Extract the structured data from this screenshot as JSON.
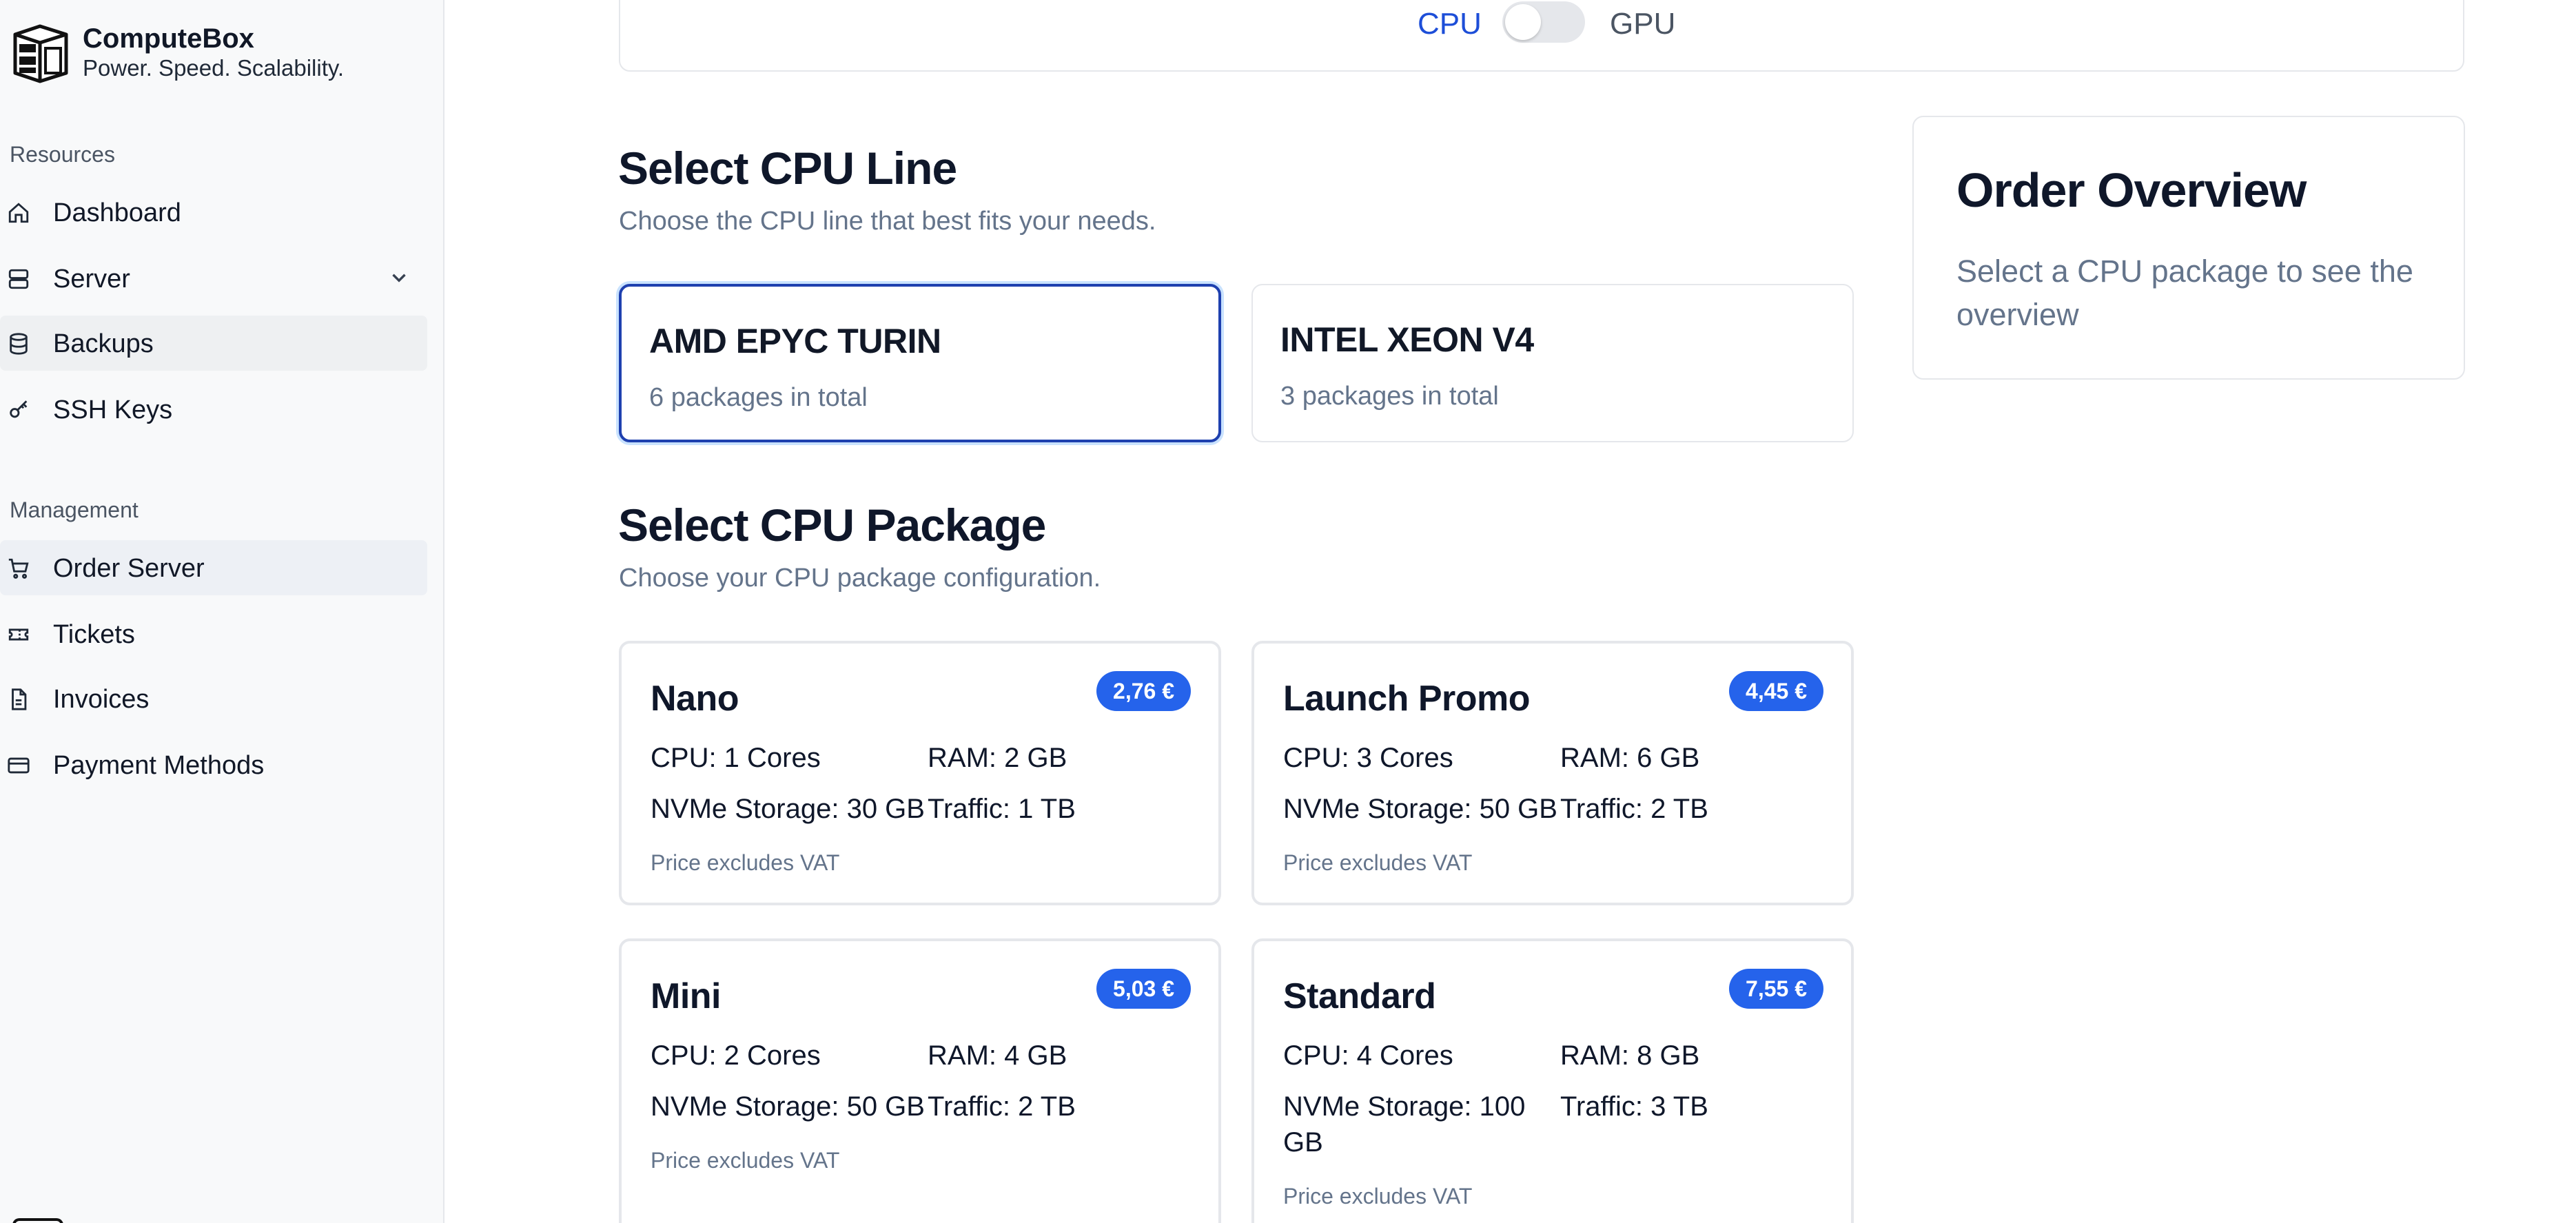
{
  "brand": {
    "name": "ComputeBox",
    "tagline": "Power. Speed. Scalability."
  },
  "sidebar": {
    "resources_label": "Resources",
    "resources": [
      {
        "label": "Dashboard",
        "icon": "home-icon"
      },
      {
        "label": "Server",
        "icon": "server-icon"
      },
      {
        "label": "Backups",
        "icon": "database-icon"
      },
      {
        "label": "SSH Keys",
        "icon": "key-icon"
      }
    ],
    "management_label": "Management",
    "management": [
      {
        "label": "Order Server",
        "icon": "cart-icon"
      },
      {
        "label": "Tickets",
        "icon": "ticket-icon"
      },
      {
        "label": "Invoices",
        "icon": "invoice-icon"
      },
      {
        "label": "Payment Methods",
        "icon": "credit-card-icon"
      }
    ]
  },
  "toggle": {
    "left": "CPU",
    "right": "GPU"
  },
  "cpu_line": {
    "title": "Select CPU Line",
    "subtitle": "Choose the CPU line that best fits your needs.",
    "options": [
      {
        "name": "AMD EPYC TURIN",
        "count": "6 packages in total"
      },
      {
        "name": "INTEL XEON V4",
        "count": "3 packages in total"
      }
    ]
  },
  "cpu_package": {
    "title": "Select CPU Package",
    "subtitle": "Choose your CPU package configuration.",
    "packages": [
      {
        "name": "Nano",
        "price": "2,76 €",
        "cpu": "CPU: 1 Cores",
        "ram": "RAM: 2 GB",
        "storage": "NVMe Storage: 30 GB",
        "traffic": "Traffic: 1 TB",
        "vat": "Price excludes VAT"
      },
      {
        "name": "Launch Promo",
        "price": "4,45 €",
        "cpu": "CPU: 3 Cores",
        "ram": "RAM: 6 GB",
        "storage": "NVMe Storage: 50 GB",
        "traffic": "Traffic: 2 TB",
        "vat": "Price excludes VAT"
      },
      {
        "name": "Mini",
        "price": "5,03 €",
        "cpu": "CPU: 2 Cores",
        "ram": "RAM: 4 GB",
        "storage": "NVMe Storage: 50 GB",
        "traffic": "Traffic: 2 TB",
        "vat": "Price excludes VAT"
      },
      {
        "name": "Standard",
        "price": "7,55 €",
        "cpu": "CPU: 4 Cores",
        "ram": "RAM: 8 GB",
        "storage": "NVMe Storage: 100 GB",
        "traffic": "Traffic: 3 TB",
        "vat": "Price excludes VAT"
      }
    ]
  },
  "overview": {
    "title": "Order Overview",
    "text": "Select a CPU package to see the overview"
  },
  "colors": {
    "accent": "#2563eb",
    "selected_border": "#1e40af",
    "muted_text": "#64748b"
  }
}
